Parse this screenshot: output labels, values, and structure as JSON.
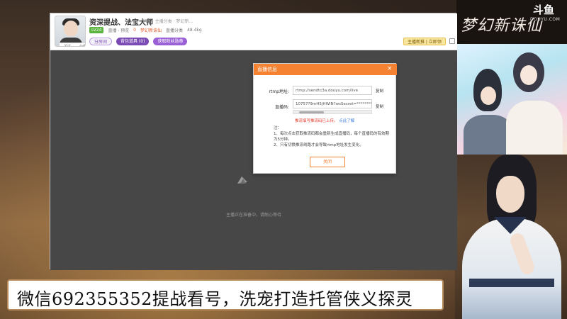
{
  "overlay": {
    "douyu_logo": "斗鱼",
    "douyu_domain": "DOUYU.COM",
    "game_logo": "梦幻新诛仙",
    "caption": "微信692355352提战看号，洗宠打造托管侠义探灵"
  },
  "room": {
    "title": "资深提战、法宝大师",
    "meta": "举报 · 主播分类 · 梦幻新...",
    "level_badge": "LV24",
    "info_items": [
      "直播 · 预览",
      "0",
      "梦幻新诛仙",
      "直播分类",
      "48.4kg"
    ],
    "avatar_tags": [
      "关注",
      "公告"
    ],
    "buttons": {
      "room_btn": "分房间",
      "bag_btn": "背包道具 (0)",
      "task_btn": "获取粉丝勋章",
      "right_btn": "主播新推 | 立即领"
    }
  },
  "player": {
    "loading_text": "主播正在准备中，请耐心等待"
  },
  "modal": {
    "title": "直播信息",
    "close_icon": "×",
    "rtmp_label": "rtmp地址:",
    "rtmp_value": "rtmp://sendtc3a.douyu.com/live",
    "code_label": "直播码:",
    "code_value": "10757?9mH5jHWlN?wsSecret=********",
    "copy_label": "复制",
    "warning": "推流填写推流码已上传。",
    "warning_link": "点此了解",
    "notes_title": "注：",
    "notes": [
      "1、每次点击获取推流码都会重新生成直播码，每个直播码的有效期为5分钟。",
      "2、只有切换推流线路才会导致rtmp地址发生变化。"
    ],
    "close_button": "关闭"
  }
}
